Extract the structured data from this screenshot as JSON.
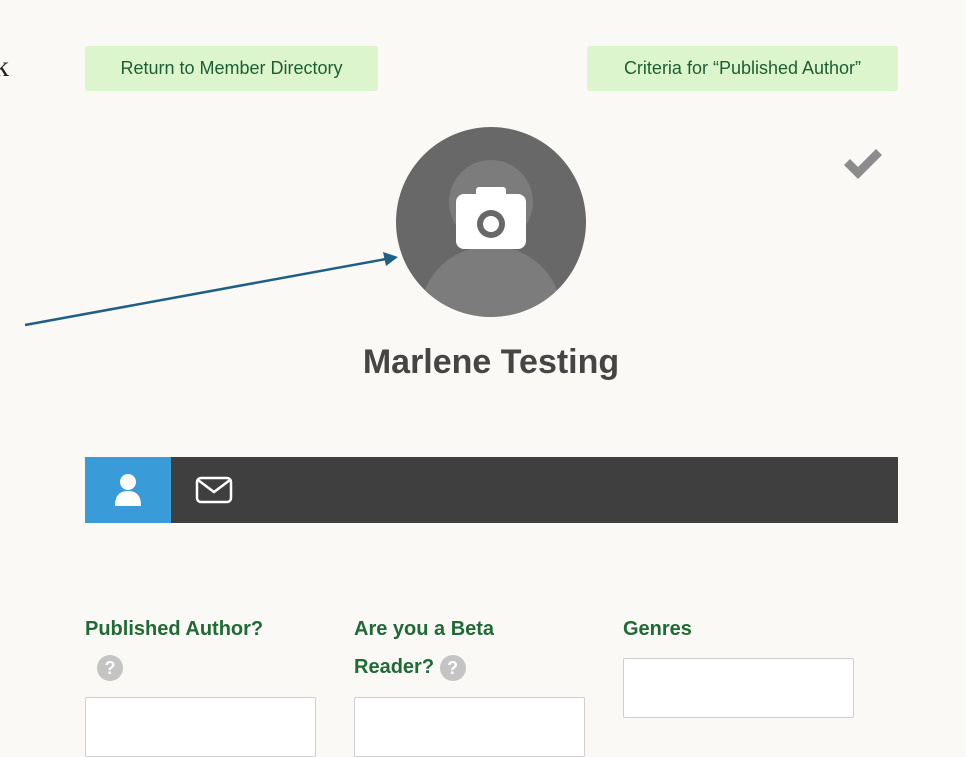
{
  "page_edge": {
    "cut_letter": "k"
  },
  "header": {
    "return_button": "Return to Member Directory",
    "criteria_button": "Criteria for “Published Author”"
  },
  "profile": {
    "name": "Marlene Testing",
    "avatar_icon": "camera-icon",
    "verified_icon": "checkmark-icon"
  },
  "tabs": [
    {
      "icon": "user-icon",
      "active": true
    },
    {
      "icon": "envelope-icon",
      "active": false
    }
  ],
  "fields": {
    "published_author": {
      "label": "Published Author?",
      "help": "?",
      "value": ""
    },
    "beta_reader": {
      "label_line1": "Are you a Beta",
      "label_line2": "Reader?",
      "help": "?",
      "value": ""
    },
    "genres": {
      "label": "Genres",
      "value": ""
    }
  },
  "colors": {
    "button_bg": "#dcf5cc",
    "button_text": "#1e5e34",
    "tab_active": "#3a9bd9",
    "tabbar": "#3f3f3f",
    "label_green": "#1f6a36",
    "annotation_arrow": "#1f5f86"
  }
}
